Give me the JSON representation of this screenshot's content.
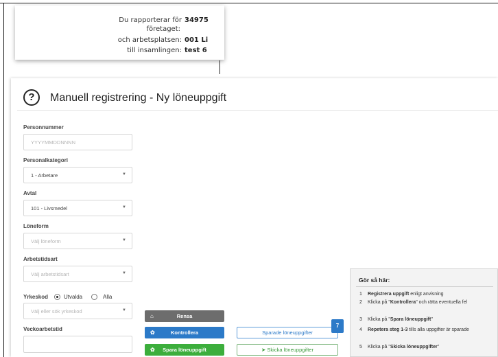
{
  "info": {
    "rows": [
      {
        "label": "Du rapporterar för",
        "value": "34975"
      },
      {
        "label": "företaget:",
        "value": ""
      },
      {
        "label": "och arbetsplatsen:",
        "value": "001 Li"
      },
      {
        "label": "till insamlingen:",
        "value": "test 6"
      }
    ]
  },
  "page": {
    "help_glyph": "?",
    "title": "Manuell registrering - Ny löneuppgift"
  },
  "form": {
    "personnummer": {
      "label": "Personnummer",
      "placeholder": "YYYYMMDDNNNN"
    },
    "personalkategori": {
      "label": "Personalkategori",
      "value": "1 - Arbetare"
    },
    "avtal": {
      "label": "Avtal",
      "value": "101 - Livsmedel"
    },
    "loneform": {
      "label": "Löneform",
      "placeholder": "Välj löneform"
    },
    "arbetstidsart": {
      "label": "Arbetstidsart",
      "placeholder": "Välj arbetstidsart"
    },
    "yrkeskod": {
      "label": "Yrkeskod",
      "options": [
        {
          "label": "Utvalda",
          "selected": true
        },
        {
          "label": "Alla",
          "selected": false
        }
      ],
      "placeholder": "Välj eller sök yrkeskod"
    },
    "veckoarbetstid": {
      "label": "Veckoarbetstid",
      "value": ""
    }
  },
  "actions": {
    "rensa": "Rensa",
    "kontrollera": "Kontrollera",
    "spara": "Spara löneuppgift",
    "sparade": "Sparade löneuppgifter",
    "sparade_count": "7",
    "skicka": "Skicka löneuppgifter"
  },
  "howto": {
    "title": "Gör så här:",
    "steps": [
      {
        "num": "1",
        "bold": "Registrera uppgift",
        "rest": " enligt anvisning"
      },
      {
        "num": "2",
        "pre": "Klicka på \"",
        "bold": "Kontrollera",
        "rest": "\" och rätta eventuella fel"
      },
      {
        "num": "3",
        "pre": "Klicka på \"",
        "bold": "Spara löneuppgift",
        "rest": "\""
      },
      {
        "num": "4",
        "bold": "Repetera steg 1-3",
        "rest": " tills alla uppgifter är sparade"
      },
      {
        "num": "5",
        "pre": "Klicka på \"",
        "bold": "Skicka löneuppgifter",
        "rest": "\""
      }
    ]
  },
  "icons": {
    "help": "question-circle-icon",
    "caret": "caret-down-icon",
    "rensa": "eraser-icon",
    "kontrollera": "gear-icon",
    "spara": "gear-icon",
    "skicka": "paper-plane-icon"
  },
  "colors": {
    "blue": "#2c7ac8",
    "green": "#3cae3c",
    "gray": "#6d6d6d"
  }
}
